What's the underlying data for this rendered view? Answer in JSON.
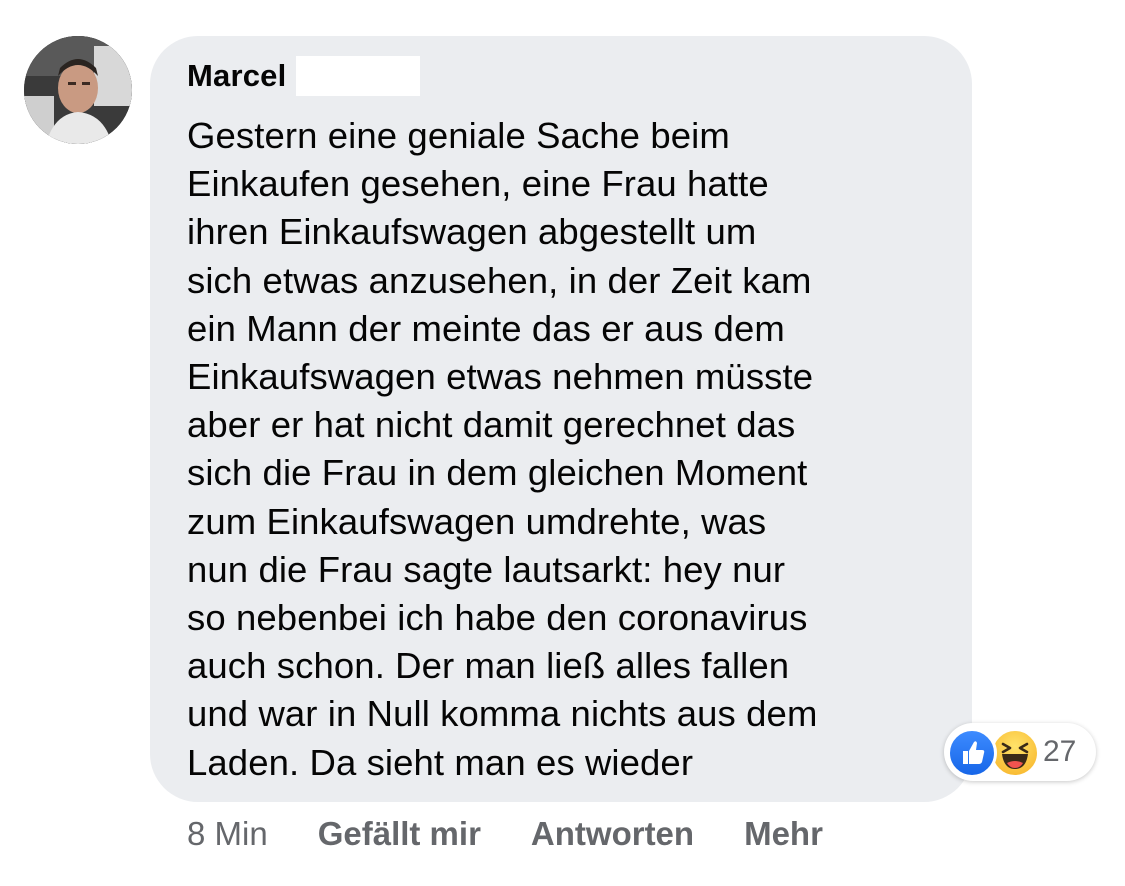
{
  "comment": {
    "author_name": "Marcel",
    "text": "Gestern eine geniale Sache beim\nEinkaufen gesehen, eine Frau hatte\nihren Einkaufswagen abgestellt um\nsich etwas anzusehen, in der Zeit kam\nein Mann der meinte das er aus dem\nEinkaufswagen etwas nehmen müsste\naber er hat nicht damit gerechnet das\nsich die Frau in dem gleichen Moment\nzum Einkaufswagen umdrehte, was\nnun die Frau sagte lautsarkt: hey nur\nso nebenbei ich habe den coronavirus\nauch schon. Der man ließ alles fallen\nund war in Null komma nichts aus dem\nLaden. Da sieht man es wieder",
    "reactions": {
      "icons": [
        "like-icon",
        "haha-icon"
      ],
      "count": "27",
      "colors": {
        "like": "#1877f2",
        "haha": "#f7b928"
      }
    },
    "meta": {
      "time": "8 Min",
      "like_label": "Gefällt mir",
      "reply_label": "Antworten",
      "more_label": "Mehr"
    }
  },
  "colors": {
    "bubble_background": "#ebedf0",
    "text": "#050505",
    "meta_text": "#65676b"
  }
}
